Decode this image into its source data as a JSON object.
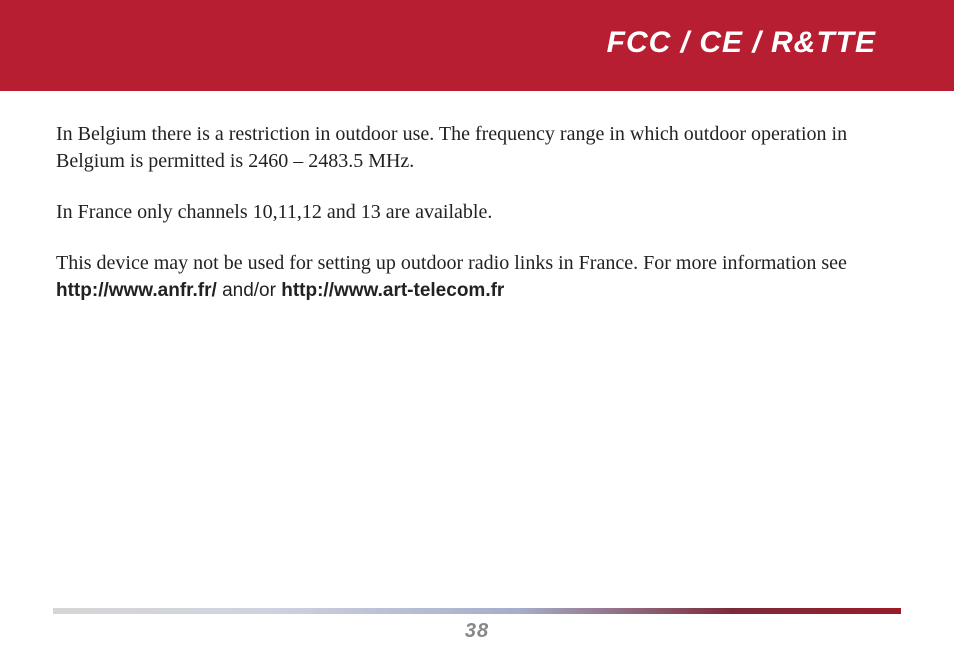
{
  "header": {
    "title": "FCC / CE / R&TTE"
  },
  "body": {
    "para1": "In Belgium there is a restriction in outdoor use. The frequency range in which outdoor operation in Belgium is permitted is 2460 – 2483.5 MHz.",
    "para2": "In France only channels 10,11,12 and 13 are available.",
    "para3_prefix": "This device may not be used for setting up outdoor radio links in France. For more information see ",
    "link1": "http://www.anfr.fr/",
    "connector": " and/or ",
    "link2": "http://www.art-telecom.fr"
  },
  "footer": {
    "page_number": "38"
  }
}
